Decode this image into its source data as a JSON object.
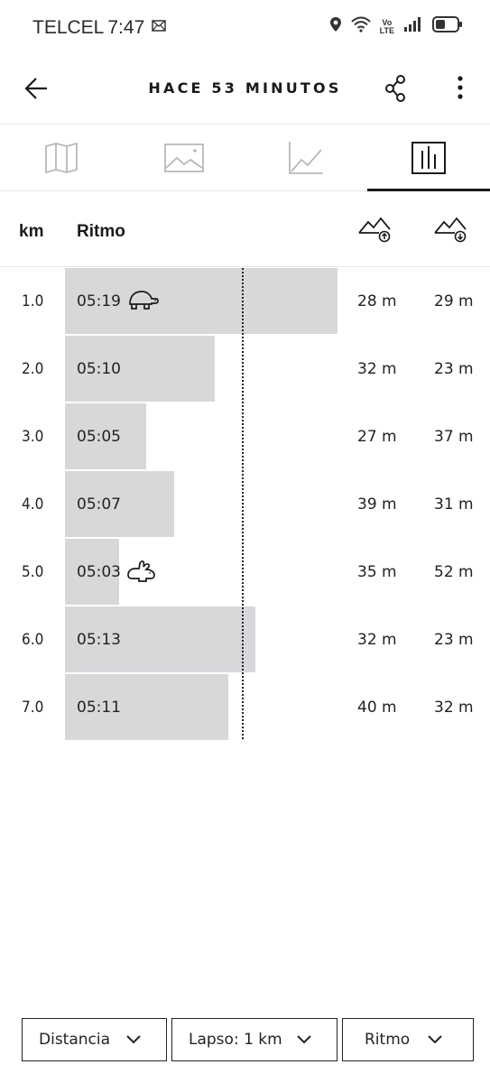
{
  "status_bar": {
    "carrier": "TELCEL",
    "time": "7:47",
    "volte_top": "Vo",
    "volte_bottom": "LTE"
  },
  "header": {
    "title": "HACE 53 MINUTOS"
  },
  "tabs": [
    {
      "name": "map",
      "icon": "map-icon",
      "active": false
    },
    {
      "name": "photos",
      "icon": "image-icon",
      "active": false
    },
    {
      "name": "graph",
      "icon": "line-chart-icon",
      "active": false
    },
    {
      "name": "splits",
      "icon": "bar-chart-icon",
      "active": true
    }
  ],
  "table": {
    "col_km": "km",
    "col_pace": "Ritmo",
    "col_ascent_icon": "ascent-icon",
    "col_descent_icon": "descent-icon",
    "rows": [
      {
        "km": "1.0",
        "pace": "05:19",
        "pace_seconds": 319,
        "ascent": "28 m",
        "descent": "29 m",
        "badge": "turtle-icon"
      },
      {
        "km": "2.0",
        "pace": "05:10",
        "pace_seconds": 310,
        "ascent": "32 m",
        "descent": "23 m",
        "badge": ""
      },
      {
        "km": "3.0",
        "pace": "05:05",
        "pace_seconds": 305,
        "ascent": "27 m",
        "descent": "37 m",
        "badge": ""
      },
      {
        "km": "4.0",
        "pace": "05:07",
        "pace_seconds": 307,
        "ascent": "39 m",
        "descent": "31 m",
        "badge": ""
      },
      {
        "km": "5.0",
        "pace": "05:03",
        "pace_seconds": 303,
        "ascent": "35 m",
        "descent": "52 m",
        "badge": "rabbit-icon"
      },
      {
        "km": "6.0",
        "pace": "05:13",
        "pace_seconds": 313,
        "ascent": "32 m",
        "descent": "23 m",
        "badge": ""
      },
      {
        "km": "7.0",
        "pace": "05:11",
        "pace_seconds": 311,
        "ascent": "40 m",
        "descent": "32 m",
        "badge": ""
      }
    ]
  },
  "filters": {
    "distance": "Distancia",
    "lap": "Lapso: 1 km",
    "metric": "Ritmo"
  },
  "colors": {
    "bar": "#d6d8da",
    "text": "#1a1a1a",
    "divider": "#e4e8e8"
  }
}
